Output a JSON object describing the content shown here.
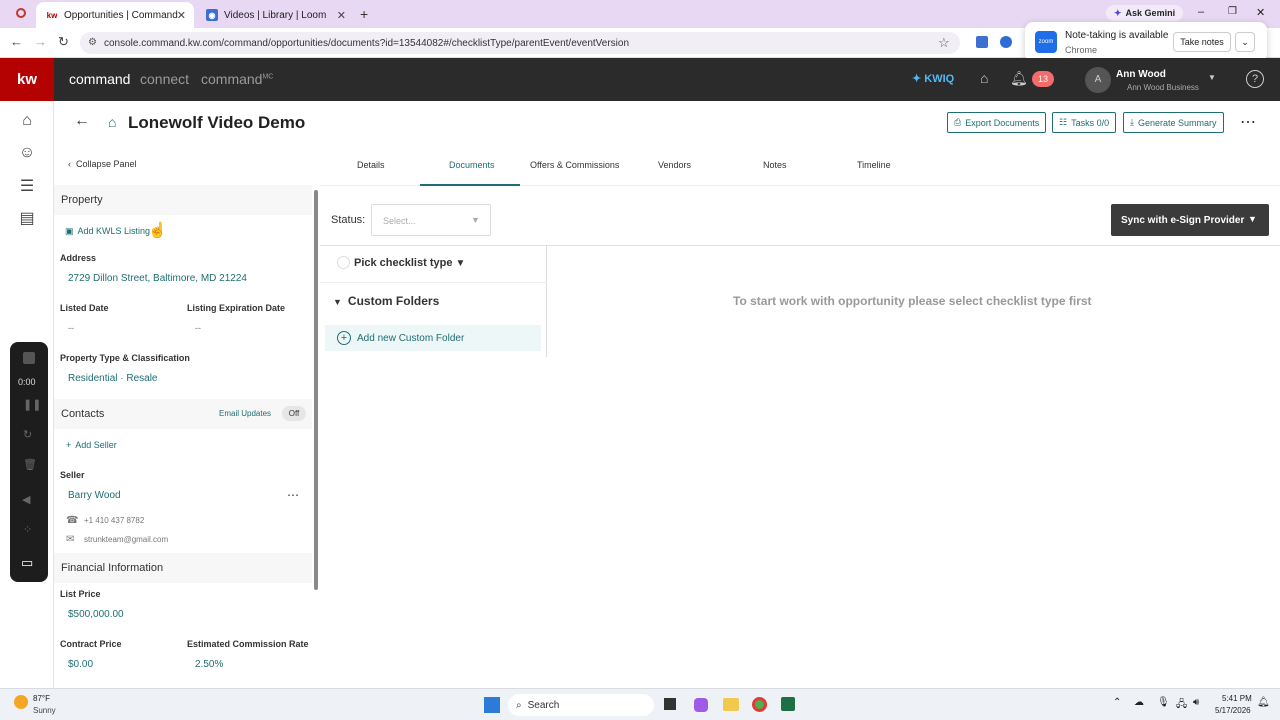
{
  "browser": {
    "tabs": [
      {
        "label": "Opportunities | Command",
        "active": true,
        "favicon": "kw"
      },
      {
        "label": "Videos | Library | Loom",
        "active": false,
        "favicon": "loom"
      }
    ],
    "url": "console.command.kw.com/command/opportunities/documents?id=13544082#/checklistType/parentEvent/eventVersion",
    "ask_gemini": "Ask Gemini"
  },
  "zoom_popup": {
    "title": "Note-taking is available",
    "subtitle": "Chrome",
    "button": "Take notes"
  },
  "app_header": {
    "logo": "kw",
    "nav": [
      "command",
      "connect",
      "command"
    ],
    "nav_sup": "MC",
    "kwiq": "KWIQ",
    "notifications": "13",
    "avatar": "A",
    "user_name": "Ann Wood",
    "user_business": "Ann Wood Business"
  },
  "rail": {
    "loom_timer": "0:00"
  },
  "page": {
    "title": "Lonewolf Video Demo",
    "export_label": "Export Documents",
    "tasks_label": "Tasks 0/0",
    "summary_label": "Generate Summary"
  },
  "left_panel": {
    "collapse": "Collapse Panel",
    "property_section": "Property",
    "add_kwls": "Add KWLS Listing",
    "address_label": "Address",
    "address_value": "2729 Dillon Street, Baltimore, MD 21224",
    "listed_date_label": "Listed Date",
    "listed_date_value": "--",
    "expiration_label": "Listing Expiration Date",
    "expiration_value": "--",
    "property_type_label": "Property Type & Classification",
    "property_type_value": "Residential · Resale",
    "contacts_section": "Contacts",
    "email_updates": "Email Updates",
    "email_updates_state": "Off",
    "add_seller": "Add Seller",
    "seller_label": "Seller",
    "seller_name": "Barry Wood",
    "seller_phone": "+1 410 437 8782",
    "seller_email": "strunkteam@gmail.com",
    "financial_section": "Financial Information",
    "list_price_label": "List Price",
    "list_price_value": "$500,000.00",
    "contract_price_label": "Contract Price",
    "contract_price_value": "$0.00",
    "commission_label": "Estimated Commission Rate",
    "commission_value": "2.50%"
  },
  "tabs": [
    "Details",
    "Documents",
    "Offers & Commissions",
    "Vendors",
    "Notes",
    "Timeline"
  ],
  "main": {
    "status_label": "Status:",
    "status_placeholder": "Select...",
    "sync_label": "Sync with e-Sign Provider",
    "pick_checklist": "Pick checklist type",
    "custom_folders": "Custom Folders",
    "add_folder": "Add new Custom Folder",
    "empty_message": "To start work with opportunity please select checklist type first"
  },
  "taskbar": {
    "temp": "87°F",
    "weather": "Sunny",
    "search": "Search",
    "time": "5:41 PM",
    "date": "5/17/2026"
  }
}
